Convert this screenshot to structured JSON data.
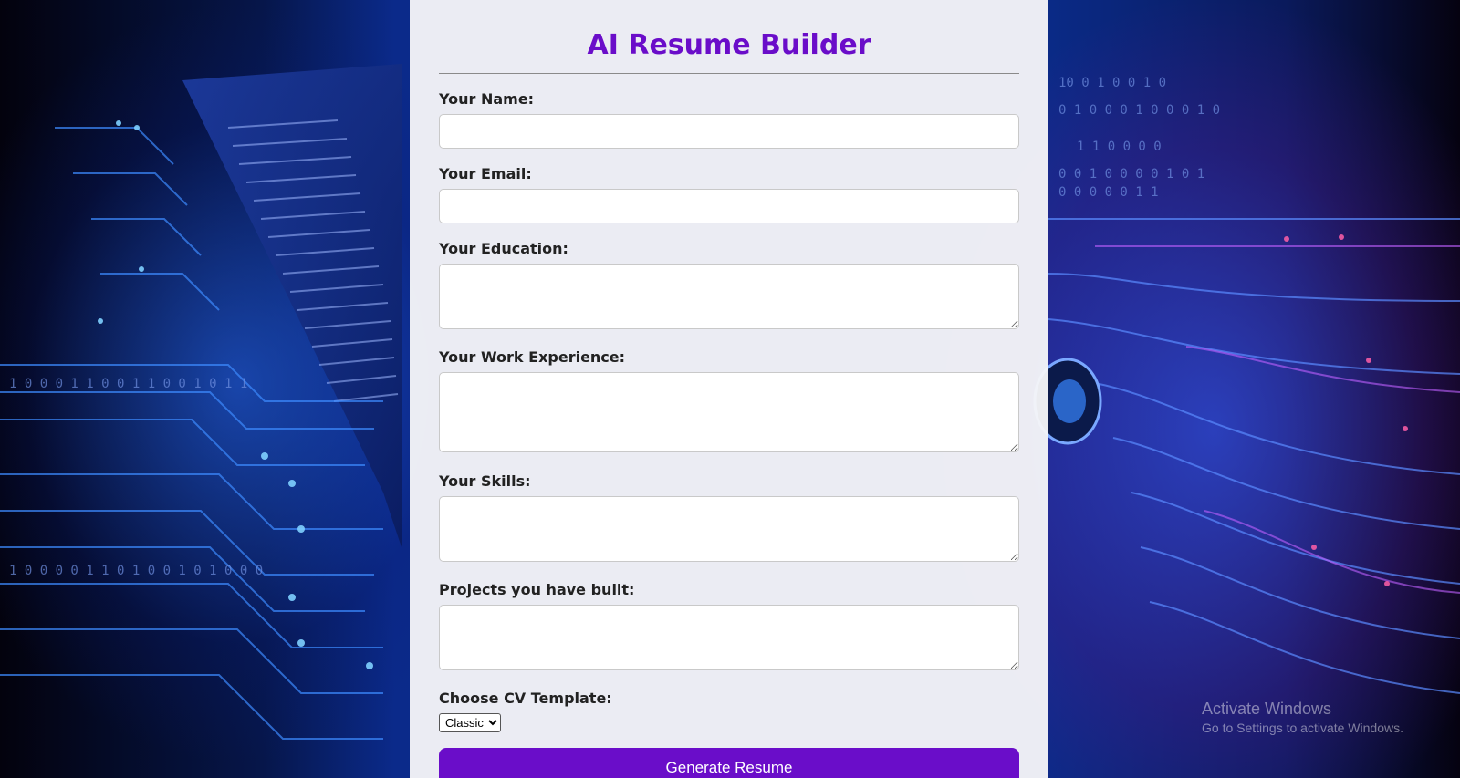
{
  "app": {
    "title": "AI Resume Builder"
  },
  "form": {
    "fields": [
      {
        "label": "Your Name:",
        "value": ""
      },
      {
        "label": "Your Email:",
        "value": ""
      },
      {
        "label": "Your Education:",
        "value": ""
      },
      {
        "label": "Your Work Experience:",
        "value": ""
      },
      {
        "label": "Your Skills:",
        "value": ""
      },
      {
        "label": "Projects you have built:",
        "value": ""
      }
    ],
    "template": {
      "label": "Choose CV Template:",
      "selected": "Classic"
    },
    "submit_label": "Generate Resume"
  },
  "watermark": {
    "line1": "Activate Windows",
    "line2": "Go to Settings to activate Windows."
  },
  "colors": {
    "accent": "#6a0dc9",
    "panel": "#f6f6f8"
  }
}
